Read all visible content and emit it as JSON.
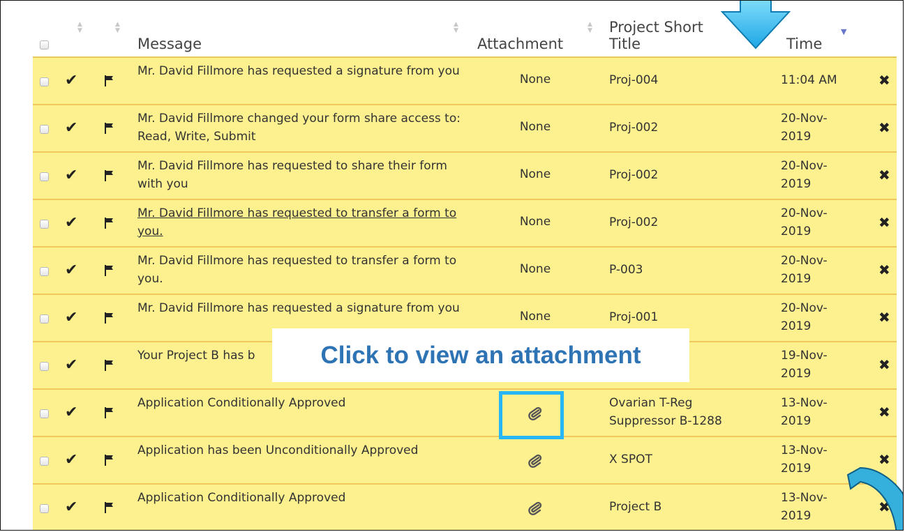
{
  "header": {
    "message": "Message",
    "attachment": "Attachment",
    "project_line1": "Project Short",
    "project_line2": "Title",
    "time": "Time"
  },
  "rows": [
    {
      "message": "Mr. David Fillmore has requested a signature from you",
      "attachment": "None",
      "project": "Proj-004",
      "time": "11:04 AM",
      "link": false
    },
    {
      "message": "Mr. David Fillmore changed your form share access to: Read, Write, Submit",
      "attachment": "None",
      "project": "Proj-002",
      "time": "20-Nov-2019",
      "link": false
    },
    {
      "message": "Mr. David Fillmore has requested to share their form with you",
      "attachment": "None",
      "project": "Proj-002",
      "time": "20-Nov-2019",
      "link": false
    },
    {
      "message": "Mr. David Fillmore has requested to transfer a form to you.",
      "attachment": "None",
      "project": "Proj-002",
      "time": "20-Nov-2019",
      "link": true
    },
    {
      "message": "Mr. David Fillmore has requested to transfer a form to you.",
      "attachment": "None",
      "project": "P-003",
      "time": "20-Nov-2019",
      "link": false
    },
    {
      "message": "Mr. David Fillmore has requested a signature from you",
      "attachment": "None",
      "project": "Proj-001",
      "time": "20-Nov-2019",
      "link": false
    },
    {
      "message": "Your Project B has b",
      "attachment": "",
      "project": "",
      "time": "19-Nov-2019",
      "link": false
    },
    {
      "message": "Application Conditionally Approved",
      "attachment": "paperclip",
      "project": "Ovarian T-Reg Suppressor B-1288",
      "time": "13-Nov-2019",
      "link": false
    },
    {
      "message": "Application has been Unconditionally Approved",
      "attachment": "paperclip",
      "project": "X SPOT",
      "time": "13-Nov-2019",
      "link": false
    },
    {
      "message": "Application Conditionally Approved",
      "attachment": "paperclip",
      "project": "Project B",
      "time": "13-Nov-2019",
      "link": false
    }
  ],
  "callout": {
    "text": "Click to view an attachment"
  },
  "colors": {
    "row_bg": "#fdf08f",
    "row_border": "#f0c85c",
    "callout_text": "#2e74b5",
    "highlight": "#29b6f6"
  },
  "icons": {
    "check": "check-icon",
    "flag": "flag-icon",
    "delete": "close-icon",
    "attachment": "paperclip-icon",
    "sort": "sort-arrows-icon"
  }
}
